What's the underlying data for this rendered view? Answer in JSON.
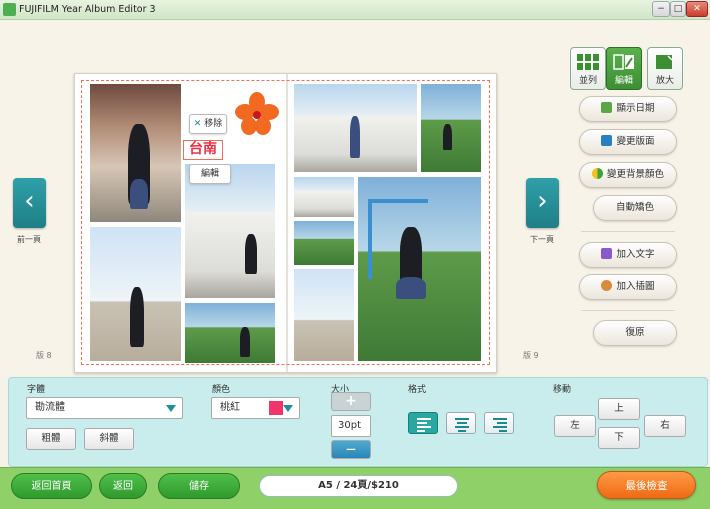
{
  "window": {
    "title": "FUJIFILM Year Album Editor 3",
    "min": "−",
    "max": "□",
    "close": "✕"
  },
  "album": {
    "move_remove_label": "移除",
    "edit_label": "編輯",
    "text_box": "台南"
  },
  "nav": {
    "prev_label": "前一頁",
    "next_label": "下一頁",
    "left_page": "版 8",
    "right_page": "版 9"
  },
  "view_modes": {
    "side_by_side": "並列",
    "edit": "編輯",
    "zoom": "放大"
  },
  "side_actions": {
    "show_date": "顯示日期",
    "change_layout": "變更版面",
    "change_bg_color": "變更背景顏色",
    "auto_color": "自動矯色",
    "add_text": "加入文字",
    "add_illustration": "加入插圖",
    "restore": "復原"
  },
  "text_panel": {
    "font_label": "字體",
    "font_value": "勘流體",
    "bold_label": "粗體",
    "italic_label": "斜體",
    "color_label": "顏色",
    "color_value": "桃紅",
    "color_swatch": "#f0356a",
    "size_label": "大小",
    "size_plus": "+",
    "size_value": "30pt",
    "size_minus": "—",
    "align_label": "格式",
    "move_label": "移動",
    "move_up": "上",
    "move_down": "下",
    "move_left": "左",
    "move_right": "右"
  },
  "bottom": {
    "home_label": "返回首頁",
    "back_label": "返回",
    "save_label": "儲存",
    "info": "A5 / 24頁/$210",
    "final_check": "最後檢查"
  }
}
